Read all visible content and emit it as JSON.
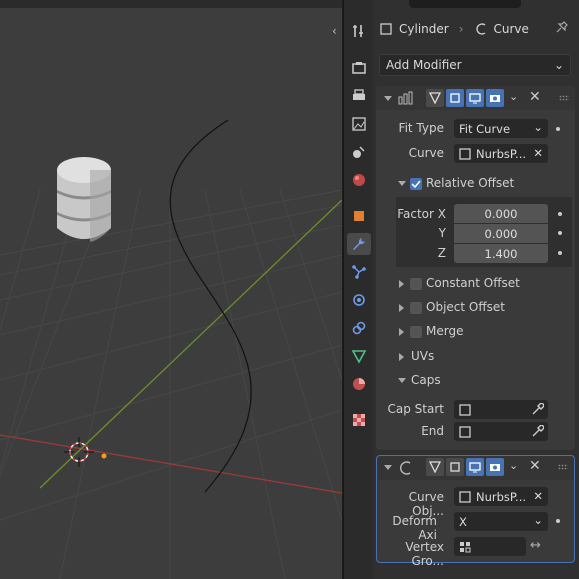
{
  "context": {
    "object_name": "Cylinder",
    "modifier_ctx": "Curve"
  },
  "add_modifier": {
    "label": "Add Modifier"
  },
  "array": {
    "fit_type_label": "Fit Type",
    "fit_type_value": "Fit Curve",
    "curve_label": "Curve",
    "curve_value": "NurbsP...",
    "relative_offset": {
      "label": "Relative Offset",
      "checked": true,
      "factor_x_label": "Factor X",
      "factor_x": "0.000",
      "y_label": "Y",
      "y": "0.000",
      "z_label": "Z",
      "z": "1.400"
    },
    "subpanels": [
      {
        "label": "Constant Offset",
        "checkbox": true
      },
      {
        "label": "Object Offset",
        "checkbox": true
      },
      {
        "label": "Merge",
        "checkbox": true
      },
      {
        "label": "UVs",
        "checkbox": false
      }
    ],
    "caps_label": "Caps",
    "cap_start_label": "Cap Start",
    "end_label": "End"
  },
  "curve_mod": {
    "curve_object_label": "Curve Obj...",
    "curve_object_value": "NurbsP...",
    "deform_axis_label": "Deform Axi",
    "deform_axis_value": "X",
    "vertex_group_label": "Vertex Gro..."
  },
  "colors": {
    "accent": "#4772b3",
    "viewport_bg": "#3d3d3d",
    "panel_bg": "#3a3a3a",
    "x_axis": "#9b3a3a",
    "y_axis": "#6b8f2b"
  },
  "icons": {
    "tabs": [
      "tool-icon",
      "render-icon",
      "output-icon",
      "view-layer-icon",
      "scene-icon",
      "world-icon",
      "object-icon",
      "modifier-wrench-icon",
      "particles-icon",
      "physics-icon",
      "constraints-icon",
      "object-data-icon",
      "material-icon",
      "texture-icon"
    ]
  }
}
